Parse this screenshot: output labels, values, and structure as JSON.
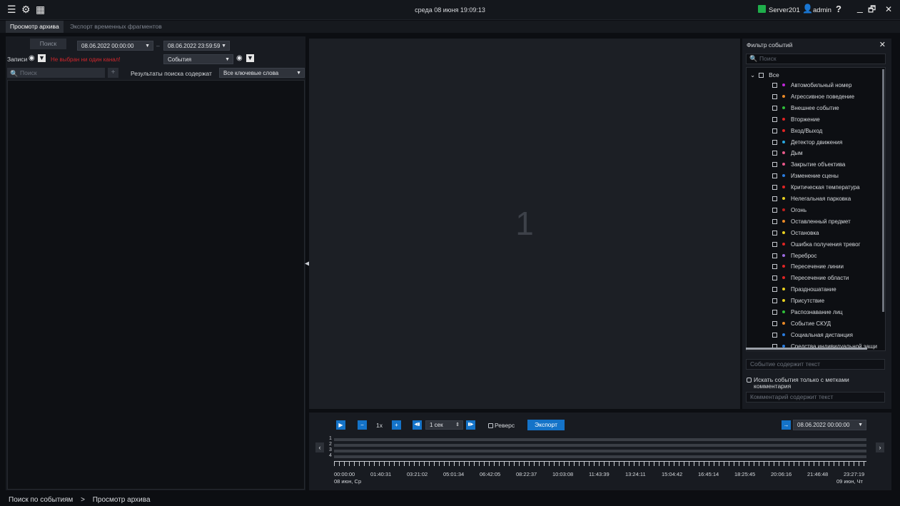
{
  "topbar": {
    "datetime": "среда 08 июня 19:09:13",
    "server": "Server201",
    "user": "admin",
    "help": "?",
    "menu_glyph": "☰",
    "settings_glyph": "⚙",
    "layout_glyph": "▦",
    "minimize_glyph": "_",
    "restore_glyph": "🗗",
    "close_glyph": "✕"
  },
  "tabs": [
    "Просмотр архива",
    "Экспорт временных фрагментов"
  ],
  "search": {
    "button": "Поиск",
    "date_from": "08.06.2022 00:00:00",
    "separator": "–",
    "date_to": "08.06.2022 23:59:59",
    "records_label": "Записи",
    "warning": "Не выбран ни один канал!",
    "events_select": "События",
    "search_placeholder": "Поиск",
    "add": "+",
    "results_label": "Результаты поиска содержат",
    "keywords_select": "Все ключевые слова"
  },
  "video": {
    "cell_number": "1"
  },
  "filter": {
    "title": "Фильтр событий",
    "close": "✕",
    "search_placeholder": "Поиск",
    "all": "Все",
    "items": [
      {
        "label": "Автомобильный номер",
        "color": "#c027d8"
      },
      {
        "label": "Агрессивное поведение",
        "color": "#ea8a27"
      },
      {
        "label": "Внешнее событие",
        "color": "#2fbf3a"
      },
      {
        "label": "Вторжение",
        "color": "#e02424"
      },
      {
        "label": "Вход/Выход",
        "color": "#e02424"
      },
      {
        "label": "Детектор движения",
        "color": "#29a8e0"
      },
      {
        "label": "Дым",
        "color": "#e85a8a"
      },
      {
        "label": "Закрытие объектива",
        "color": "#e8578a"
      },
      {
        "label": "Изменение сцены",
        "color": "#2a7de0"
      },
      {
        "label": "Критическая температура",
        "color": "#e02424"
      },
      {
        "label": "Нелегальная парковка",
        "color": "#e8d020"
      },
      {
        "label": "Огонь",
        "color": "#c0201e"
      },
      {
        "label": "Оставленный предмет",
        "color": "#ea8a27"
      },
      {
        "label": "Остановка",
        "color": "#e8d020"
      },
      {
        "label": "Ошибка получения тревог",
        "color": "#e02424"
      },
      {
        "label": "Переброс",
        "color": "#9b6be0"
      },
      {
        "label": "Пересечение линии",
        "color": "#e02424"
      },
      {
        "label": "Пересечение области",
        "color": "#e02424"
      },
      {
        "label": "Праздношатание",
        "color": "#e8d020"
      },
      {
        "label": "Присутствие",
        "color": "#e8d020"
      },
      {
        "label": "Распознавание лиц",
        "color": "#2fbf3a"
      },
      {
        "label": "Событие СКУД",
        "color": "#ea8a27"
      },
      {
        "label": "Социальная дистанция",
        "color": "#2a7de0"
      },
      {
        "label": "Средства индивидуальной защи",
        "color": "#2a7de0"
      }
    ],
    "text_placeholder": "Событие содержит текст",
    "comment_check": "Искать события только с метками комментария",
    "comment_placeholder": "Комментарий содержит текст"
  },
  "timeline": {
    "speed": "1x",
    "step": "1 сек",
    "reverse": "Реверс",
    "export": "Экспорт",
    "goto_date": "08.06.2022 00:00:00",
    "rows": [
      "1",
      "2",
      "3",
      "4"
    ],
    "labels": [
      "00:00:00",
      "01:40:31",
      "03:21:02",
      "05:01:34",
      "06:42:05",
      "08:22:37",
      "10:03:08",
      "11:43:39",
      "13:24:11",
      "15:04:42",
      "16:45:14",
      "18:25:45",
      "20:06:16",
      "21:46:48",
      "23:27:19"
    ],
    "start_day": "08 июн, Ср",
    "end_day": "09 июн, Чт"
  },
  "breadcrumb": {
    "root": "Поиск по событиям",
    "sep": ">",
    "current": "Просмотр архива"
  }
}
